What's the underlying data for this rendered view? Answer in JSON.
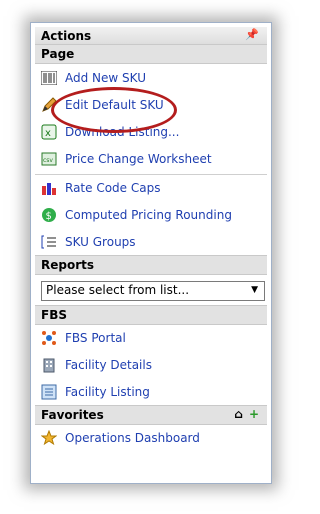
{
  "panel": {
    "title": "Actions"
  },
  "sections": {
    "page": "Page",
    "reports": "Reports",
    "fbs": "FBS",
    "favorites": "Favorites"
  },
  "page_items": [
    {
      "label": "Add New SKU",
      "icon": "barcode-icon"
    },
    {
      "label": "Edit Default SKU",
      "icon": "pencil-icon"
    },
    {
      "label": "Download Listing...",
      "icon": "excel-icon"
    },
    {
      "label": "Price Change Worksheet",
      "icon": "csv-icon"
    },
    {
      "label": "Rate Code Caps",
      "icon": "bar-chart-icon"
    },
    {
      "label": "Computed Pricing Rounding",
      "icon": "dollar-icon"
    },
    {
      "label": "SKU Groups",
      "icon": "list-bracket-icon"
    }
  ],
  "reports": {
    "select_value": "Please select from list..."
  },
  "fbs_items": [
    {
      "label": "FBS Portal",
      "icon": "network-icon"
    },
    {
      "label": "Facility Details",
      "icon": "building-icon"
    },
    {
      "label": "Facility Listing",
      "icon": "listing-icon"
    }
  ],
  "favorites_items": [
    {
      "label": "Operations Dashboard",
      "icon": "star-icon"
    }
  ],
  "colors": {
    "link": "#1f3fb0",
    "highlight": "#b41d1d"
  }
}
